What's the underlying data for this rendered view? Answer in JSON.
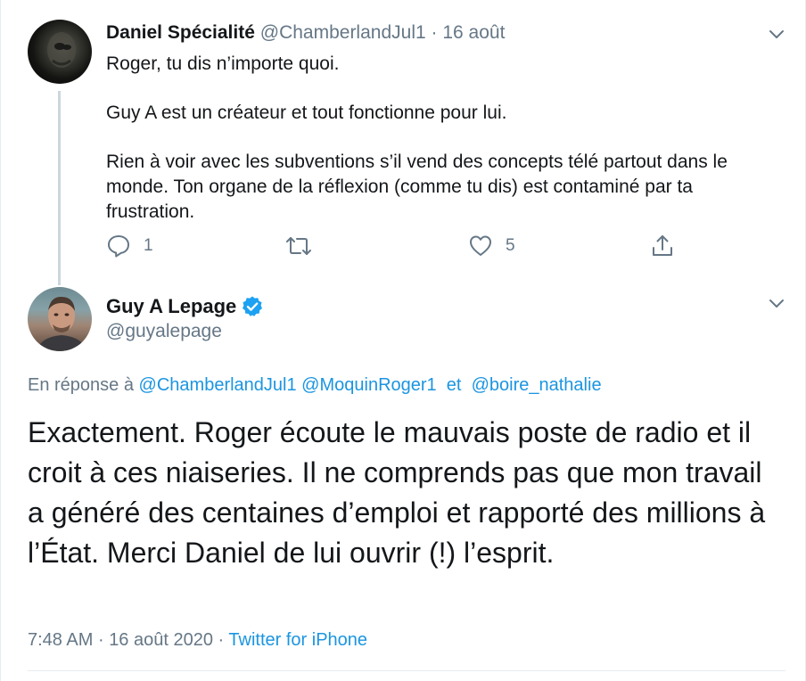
{
  "reply_tweet": {
    "author_name": "Daniel Spécialité",
    "author_handle": "@ChamberlandJul1",
    "separator": "·",
    "date": "16 août",
    "paragraphs": [
      "Roger, tu dis n’importe quoi.",
      "Guy A est un créateur et tout fonctionne pour lui.",
      "Rien à voir avec les subventions s’il vend des concepts télé partout dans le monde.  Ton organe de la réflexion (comme tu dis) est contaminé par ta frustration."
    ],
    "actions": {
      "reply_icon": "reply-icon",
      "reply_count": "1",
      "retweet_icon": "retweet-icon",
      "like_icon": "heart-icon",
      "like_count": "5",
      "share_icon": "share-icon"
    }
  },
  "main_tweet": {
    "author_name": "Guy A Lepage",
    "verified_icon": "verified-badge-icon",
    "author_handle": "@guyalepage",
    "reply_to_prefix": "En réponse à",
    "reply_to_handles": [
      "@ChamberlandJul1",
      "@MoquinRoger1",
      "@boire_nathalie"
    ],
    "reply_to_conjunction": "et",
    "text": "Exactement. Roger écoute le mauvais poste de radio et il croit à ces niaiseries. Il ne comprends pas que mon travail a généré des centaines d’emploi et rapporté des millions à l’État. Merci Daniel de lui ouvrir (!) l’esprit.",
    "time": "7:48 AM",
    "date": "16 août 2020",
    "separator": "·",
    "source": "Twitter for iPhone"
  },
  "colors": {
    "text": "#14171a",
    "muted": "#657786",
    "link": "#1b95e0",
    "verified": "#1da1f2",
    "thread_line": "#ccd6dd",
    "divider": "#e6ecf0"
  }
}
